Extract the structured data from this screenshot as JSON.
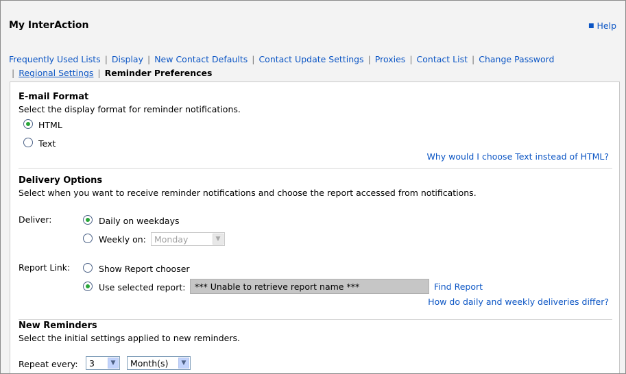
{
  "header": {
    "title": "My InterAction",
    "help_label": "Help"
  },
  "tabs": [
    {
      "label": "Frequently Used Lists"
    },
    {
      "label": "Display"
    },
    {
      "label": "New Contact Defaults"
    },
    {
      "label": "Contact Update Settings"
    },
    {
      "label": "Proxies"
    },
    {
      "label": "Contact List"
    },
    {
      "label": "Change Password"
    },
    {
      "label": "Regional Settings"
    },
    {
      "label": "Reminder Preferences"
    }
  ],
  "email_format": {
    "title": "E-mail Format",
    "description": "Select the display format for reminder notifications.",
    "options": [
      {
        "label": "HTML",
        "selected": true
      },
      {
        "label": "Text",
        "selected": false
      }
    ],
    "help_link": "Why would I choose Text instead of HTML?"
  },
  "delivery": {
    "title": "Delivery Options",
    "description": "Select when you want to receive reminder notifications and choose the report accessed from notifications.",
    "deliver_label": "Deliver:",
    "daily_label": "Daily on weekdays",
    "weekly_label": "Weekly on:",
    "weekly_day": "Monday",
    "report_link_label": "Report Link:",
    "show_chooser_label": "Show Report chooser",
    "use_selected_label": "Use selected report:",
    "selected_report": "*** Unable to retrieve report name ***",
    "find_report": "Find Report",
    "help_link": "How do daily and weekly deliveries differ?"
  },
  "new_reminders": {
    "title": "New Reminders",
    "description": "Select the initial settings applied to new reminders.",
    "repeat_label": "Repeat every:",
    "repeat_value": "3",
    "repeat_unit": "Month(s)"
  },
  "colors": {
    "link": "#0b55c4",
    "radio_selected": "#2aa63a",
    "report_box": "#c6c6c6"
  }
}
